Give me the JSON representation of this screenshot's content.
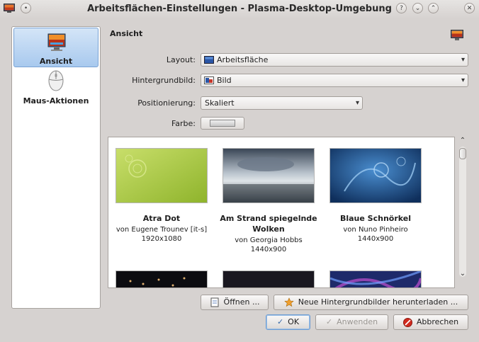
{
  "window": {
    "title": "Arbeitsflächen-Einstellungen - Plasma-Desktop-Umgebung",
    "buttons": {
      "help": "?",
      "minimize": "⌄",
      "maximize": "⌃",
      "close": "✕"
    }
  },
  "sidebar": {
    "items": [
      {
        "label": "Ansicht",
        "icon": "monitor-icon"
      },
      {
        "label": "Maus-Aktionen",
        "icon": "mouse-icon"
      }
    ]
  },
  "main": {
    "section_title": "Ansicht",
    "fields": {
      "layout": {
        "label": "Layout:",
        "value": "Arbeitsfläche"
      },
      "wallpaper": {
        "label": "Hintergrundbild:",
        "value": "Bild"
      },
      "positioning": {
        "label": "Positionierung:",
        "value": "Skaliert"
      },
      "color": {
        "label": "Farbe:"
      }
    },
    "wallpapers": [
      {
        "name": "Atra Dot",
        "author": "von Eugene Trounev [it-s]",
        "resolution": "1920x1080"
      },
      {
        "name": "Am Strand spiegelnde Wolken",
        "author": "von Georgia Hobbs",
        "resolution": "1440x900"
      },
      {
        "name": "Blaue Schnörkel",
        "author": "von Nuno Pinheiro",
        "resolution": "1440x900"
      }
    ],
    "open_button": "Öffnen ...",
    "download_button": "Neue Hintergrundbilder herunterladen ..."
  },
  "footer": {
    "ok": "OK",
    "apply": "Anwenden",
    "cancel": "Abbrechen"
  }
}
